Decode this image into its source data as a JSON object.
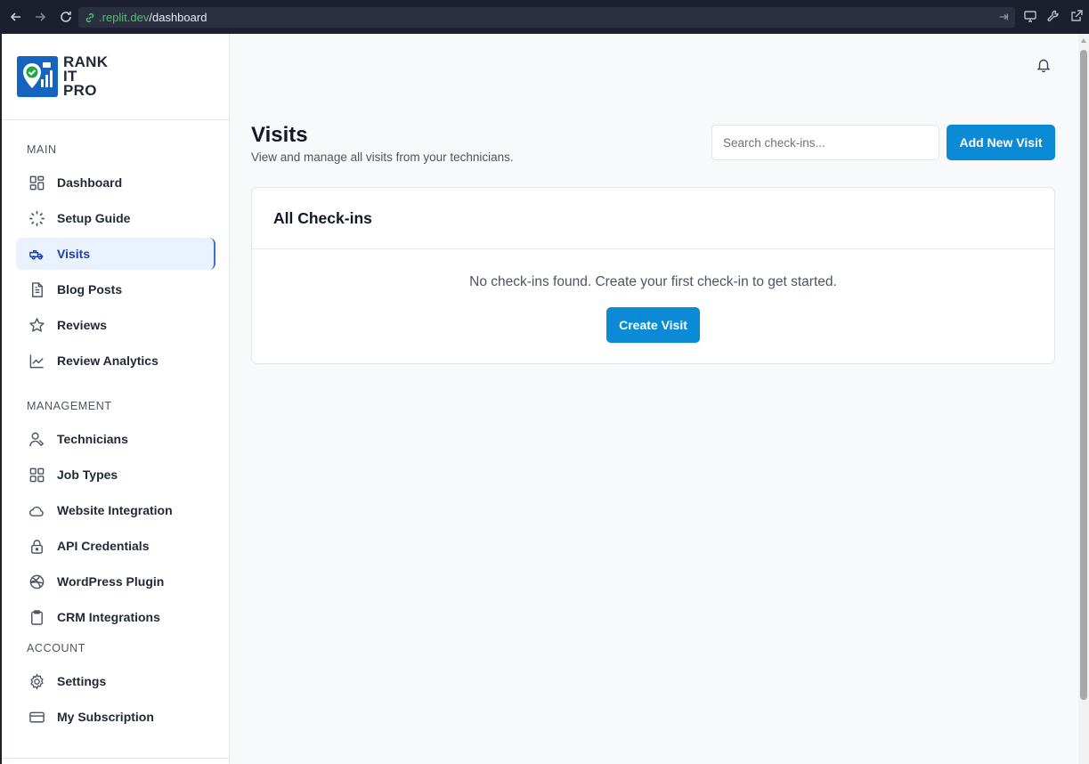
{
  "browser": {
    "url_domain": ".replit.dev",
    "url_path": "/dashboard"
  },
  "logo": {
    "line1": "RANK",
    "line2": "IT",
    "line3": "PRO",
    "brand_color": "#1565c0"
  },
  "sidebar": {
    "sections": {
      "main": "MAIN",
      "management": "MANAGEMENT",
      "account": "ACCOUNT"
    },
    "items": [
      {
        "label": "Dashboard",
        "icon": "grid-icon"
      },
      {
        "label": "Setup Guide",
        "icon": "loader-icon"
      },
      {
        "label": "Visits",
        "icon": "truck-icon",
        "active": true
      },
      {
        "label": "Blog Posts",
        "icon": "document-icon"
      },
      {
        "label": "Reviews",
        "icon": "star-icon"
      },
      {
        "label": "Review Analytics",
        "icon": "chart-line-icon"
      },
      {
        "label": "Technicians",
        "icon": "user-wrench-icon"
      },
      {
        "label": "Job Types",
        "icon": "grid-icon"
      },
      {
        "label": "Website Integration",
        "icon": "cloud-icon"
      },
      {
        "label": "API Credentials",
        "icon": "lock-icon"
      },
      {
        "label": "WordPress Plugin",
        "icon": "dribbble-icon"
      },
      {
        "label": "CRM Integrations",
        "icon": "clipboard-icon"
      },
      {
        "label": "Settings",
        "icon": "gear-icon"
      },
      {
        "label": "My Subscription",
        "icon": "credit-card-icon"
      }
    ]
  },
  "main": {
    "title": "Visits",
    "subtitle": "View and manage all visits from your technicians.",
    "search_placeholder": "Search check-ins...",
    "add_button": "Add New Visit",
    "card_title": "All Check-ins",
    "empty_message": "No check-ins found. Create your first check-in to get started.",
    "create_button": "Create Visit"
  },
  "colors": {
    "primary": "#0b8ad6",
    "active_bg": "#eaf2fd",
    "active_text": "#1e40af"
  }
}
